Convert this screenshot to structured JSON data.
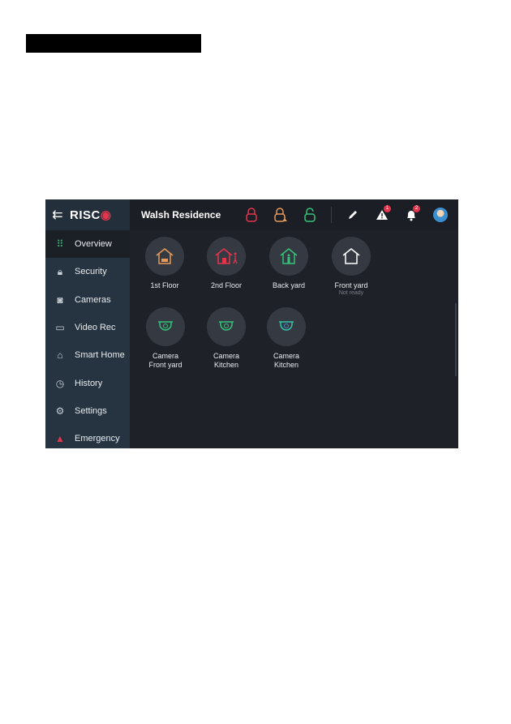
{
  "header": {
    "title": "Walsh Residence",
    "logo": "RISCO",
    "alerts_count": "1",
    "notifications_count": "2",
    "icons": [
      "back-arrow-icon",
      "lock-armed-icon",
      "lock-partial-icon",
      "lock-disarmed-icon",
      "edit-icon",
      "alert-icon",
      "bell-icon",
      "avatar"
    ]
  },
  "colors": {
    "armed": "#e3344c",
    "partial": "#e59a5a",
    "disarmed": "#35c27a",
    "active_nav": "#35c27a"
  },
  "sidebar": {
    "items": [
      {
        "label": "Overview",
        "icon": "grid-icon"
      },
      {
        "label": "Security",
        "icon": "lock-icon"
      },
      {
        "label": "Cameras",
        "icon": "camera-icon"
      },
      {
        "label": "Video Rec",
        "icon": "video-icon"
      },
      {
        "label": "Smart Home",
        "icon": "smart-home-icon"
      },
      {
        "label": "History",
        "icon": "history-icon"
      },
      {
        "label": "Settings",
        "icon": "gear-icon"
      },
      {
        "label": "Emergency",
        "icon": "siren-icon"
      }
    ]
  },
  "partitions": [
    {
      "label": "1st Floor",
      "status": ""
    },
    {
      "label": "2nd Floor",
      "status": ""
    },
    {
      "label": "Back yard",
      "status": ""
    },
    {
      "label": "Front yard",
      "status": "Not ready"
    }
  ],
  "cameras": [
    {
      "line1": "Camera",
      "line2": "Front yard"
    },
    {
      "line1": "Camera",
      "line2": "Kitchen"
    },
    {
      "line1": "Camera",
      "line2": "Kitchen"
    }
  ]
}
